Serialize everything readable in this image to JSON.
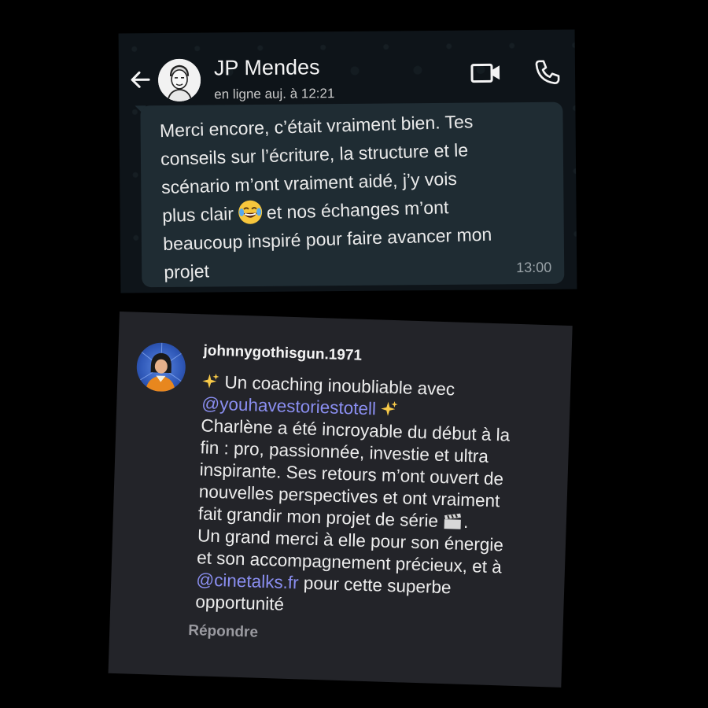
{
  "whatsapp": {
    "contact_name": "JP Mendes",
    "status": "en ligne auj. à 12:21",
    "message": {
      "line1": "Merci encore, c’était vraiment bien. Tes",
      "line2": "conseils sur l’écriture, la structure et le",
      "line3": "scénario m’ont vraiment aidé, j’y vois",
      "line4_before_emoji": "plus clair",
      "line4_after_emoji": "et nos échanges m’ont",
      "line5": "beaucoup inspiré pour faire avancer mon",
      "line6": "projet",
      "emoji": "laughing-with-tears-emoji",
      "time": "13:00"
    },
    "icons": [
      "back-arrow-icon",
      "video-call-icon",
      "phone-call-icon"
    ]
  },
  "comment": {
    "username": "johnnygothisgun.1971",
    "line1_text": "Un coaching inoubliable avec",
    "mention1": "@youhavestoriestotell",
    "body_lines": [
      "Charlène a été incroyable du début à la",
      "fin : pro, passionnée, investie et ultra",
      "inspirante. Ses retours m’ont ouvert de",
      "nouvelles perspectives et ont vraiment"
    ],
    "line_clap_text": "fait grandir mon projet de série",
    "line_thanks": "Un grand merci à elle pour son énergie",
    "line_accomp": "et son accompagnement précieux, et à",
    "mention2": "@cinetalks.fr",
    "after_mention2": "pour cette superbe",
    "last_line": "opportunité",
    "reply_label": "Répondre",
    "icons": [
      "sparkles-icon",
      "clapperboard-icon"
    ],
    "mention_color": "#8a8ef0"
  }
}
